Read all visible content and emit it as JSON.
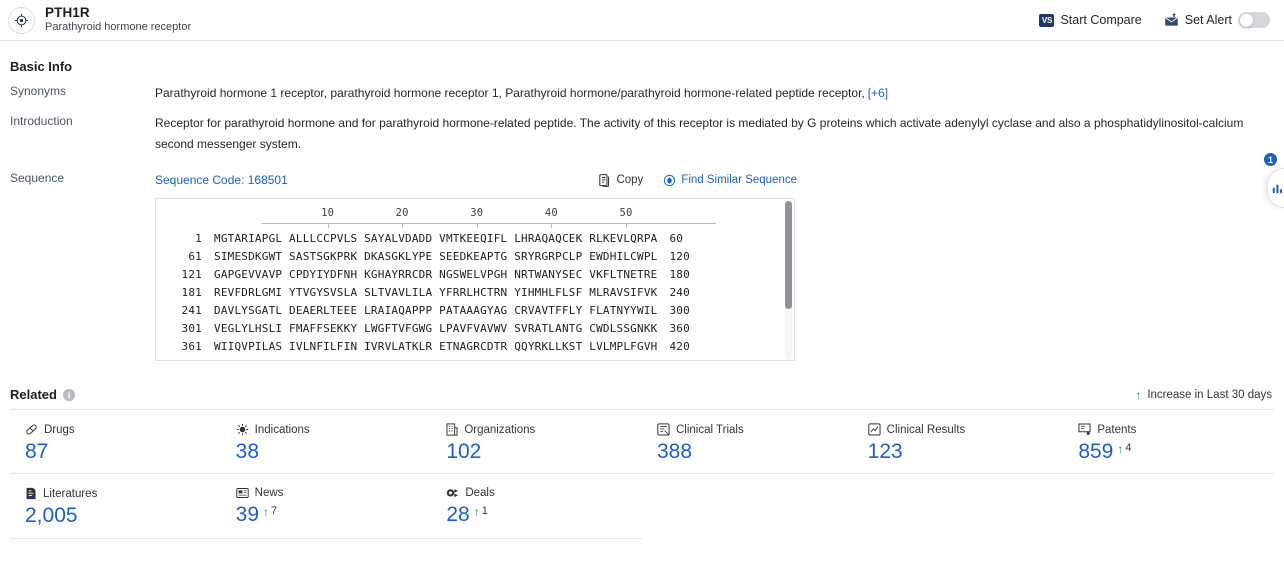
{
  "header": {
    "icon": "target-icon",
    "title": "PTH1R",
    "subtitle": "Parathyroid hormone receptor",
    "start_compare": "Start Compare",
    "vs_badge": "VS",
    "set_alert": "Set Alert",
    "alert_toggle_state": "off"
  },
  "basic_info": {
    "title": "Basic Info",
    "synonyms_label": "Synonyms",
    "synonyms_value": "Parathyroid hormone 1 receptor,  parathyroid hormone receptor 1,  Parathyroid hormone/parathyroid hormone-related peptide receptor,",
    "synonyms_more": "[+6]",
    "introduction_label": "Introduction",
    "introduction_value": "Receptor for parathyroid hormone and for parathyroid hormone-related peptide. The activity of this receptor is mediated by G proteins which activate adenylyl cyclase and also a phosphatidylinositol-calcium second messenger system.",
    "sequence_label": "Sequence",
    "sequence_code": "Sequence Code: 168501",
    "copy_label": "Copy",
    "find_similar_label": "Find Similar Sequence"
  },
  "sequence": {
    "ruler_ticks": [
      10,
      20,
      30,
      40,
      50
    ],
    "rows": [
      {
        "start": "1",
        "chunks": "MGTARIAPGL ALLLCCPVLS SAYALVDADD VMTKEEQIFL LHRAQAQCEK RLKEVLQRPA",
        "end": "60"
      },
      {
        "start": "61",
        "chunks": "SIMESDKGWT SASTSGKPRK DKASGKLYPE SEEDKEAPTG SRYRGRPCLP EWDHILCWPL",
        "end": "120"
      },
      {
        "start": "121",
        "chunks": "GAPGEVVAVP CPDYIYDFNH KGHAYRRCDR NGSWELVPGH NRTWANYSEC VKFLTNETRE",
        "end": "180"
      },
      {
        "start": "181",
        "chunks": "REVFDRLGMI YTVGYSVSLA SLTVAVLILA YFRRLHCTRN YIHMHLFLSF MLRAVSIFVK",
        "end": "240"
      },
      {
        "start": "241",
        "chunks": "DAVLYSGATL DEAERLTEEE LRAIAQAPPP PATAAAGYAG CRVAVTFFLY FLATNYYWIL",
        "end": "300"
      },
      {
        "start": "301",
        "chunks": "VEGLYLHSLI FMAFFSEKKY LWGFTVFGWG LPAVFVAVWV SVRATLANTG CWDLSSGNKK",
        "end": "360"
      },
      {
        "start": "361",
        "chunks": "WIIQVPILAS IVLNFILFIN IVRVLATKLR ETNAGRCDTR QQYRKLLKST LVLMPLFGVH",
        "end": "420"
      }
    ]
  },
  "related": {
    "title": "Related",
    "info_icon": "info-icon",
    "legend_label": "Increase in Last 30 days",
    "legend_arrow": "↑",
    "items": [
      {
        "icon": "pill-icon",
        "label": "Drugs",
        "value": "87",
        "delta": ""
      },
      {
        "icon": "virus-icon",
        "label": "Indications",
        "value": "38",
        "delta": ""
      },
      {
        "icon": "building-icon",
        "label": "Organizations",
        "value": "102",
        "delta": ""
      },
      {
        "icon": "clinical-trial-icon",
        "label": "Clinical Trials",
        "value": "388",
        "delta": ""
      },
      {
        "icon": "clinical-result-icon",
        "label": "Clinical Results",
        "value": "123",
        "delta": ""
      },
      {
        "icon": "patent-icon",
        "label": "Patents",
        "value": "859",
        "delta": "4"
      },
      {
        "icon": "literature-icon",
        "label": "Literatures",
        "value": "2,005",
        "delta": ""
      },
      {
        "icon": "news-icon",
        "label": "News",
        "value": "39",
        "delta": "7"
      },
      {
        "icon": "deal-icon",
        "label": "Deals",
        "value": "28",
        "delta": "1"
      }
    ]
  },
  "float_widget": {
    "badge": "1",
    "icon": "bar-chart-icon"
  },
  "colors": {
    "link_blue": "#1a5fd0",
    "increase_green": "#17913a",
    "badge_navy": "#1f3864"
  }
}
